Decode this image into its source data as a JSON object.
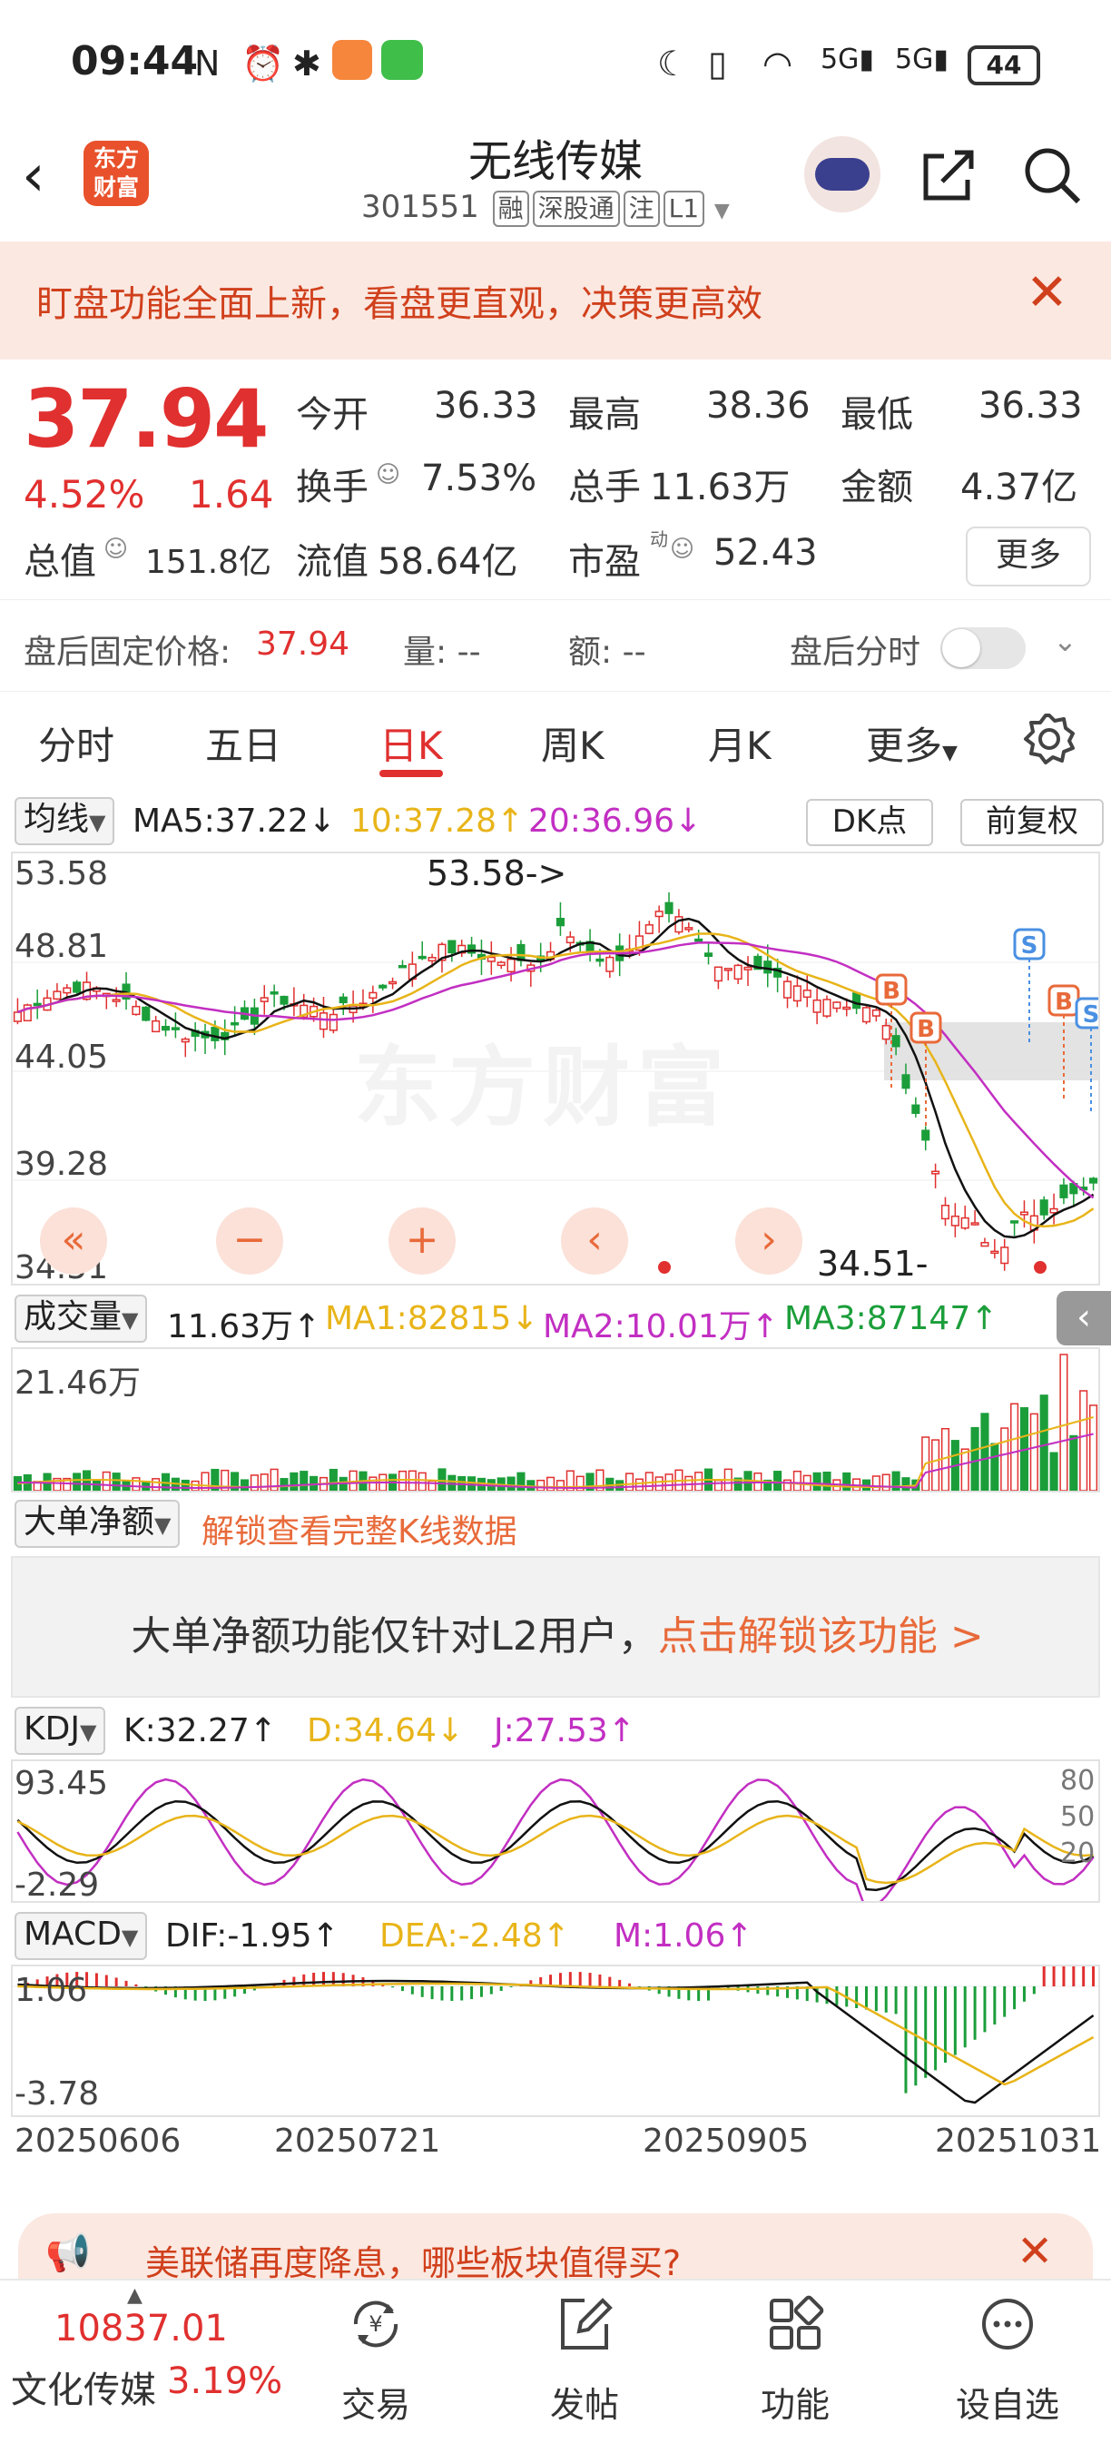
{
  "status_bar": {
    "time": "09:44",
    "battery": "44"
  },
  "header": {
    "logo_text": "东方财富",
    "stock_name": "无线传媒",
    "stock_code": "301551",
    "tags": [
      "融",
      "深股通",
      "注",
      "L1"
    ]
  },
  "banner": {
    "text": "盯盘功能全面上新，看盘更直观，决策更高效",
    "close": "✕"
  },
  "quote": {
    "price": "37.94",
    "change_pct": "4.52%",
    "change": "1.64",
    "fields": [
      {
        "label": "今开",
        "value": "36.33",
        "color": "#e0302f"
      },
      {
        "label": "最高",
        "value": "38.36",
        "color": "#e0302f"
      },
      {
        "label": "最低",
        "value": "36.33",
        "color": "#e0302f"
      },
      {
        "label": "换手",
        "value": "7.53%",
        "color": "#333333"
      },
      {
        "label": "总手",
        "value": "11.63万",
        "color": "#333333"
      },
      {
        "label": "金额",
        "value": "4.37亿",
        "color": "#333333"
      }
    ],
    "market_cap_label": "总值",
    "market_cap": "151.8亿",
    "float_cap_label": "流值",
    "float_cap": "58.64亿",
    "pe_label": "市盈",
    "pe_sup": "动",
    "pe": "52.43",
    "more_button": "更多"
  },
  "after_hours": {
    "price_label": "盘后固定价格:",
    "price": "37.94",
    "volume_label": "量: --",
    "amount_label": "额: --",
    "timeshare_label": "盘后分时"
  },
  "tabs": [
    "分时",
    "五日",
    "日K",
    "周K",
    "月K",
    "更多"
  ],
  "active_tab": "日K",
  "kline": {
    "selector": "均线",
    "ma5": "MA5:37.22↓",
    "ma10": "10:37.28↑",
    "ma20": "20:36.96↓",
    "dk_button": "DK点",
    "adjust_button": "前复权",
    "y_top": "53.58",
    "y_2": "48.81",
    "y_3": "44.05",
    "y_4": "39.28",
    "y_bottom": "34.51",
    "max_marker": "53.58->",
    "min_marker": "34.51-",
    "watermark": "东方财富",
    "signals": [
      "B",
      "B",
      "S",
      "B",
      "S"
    ]
  },
  "nav_buttons": [
    "«",
    "−",
    "+",
    "‹",
    "›"
  ],
  "volume": {
    "selector": "成交量",
    "value": "11.63万↑",
    "ma1": "MA1:82815↓",
    "ma2": "MA2:10.01万↑",
    "ma3": "MA3:87147↑",
    "y_top": "21.46万"
  },
  "big_order": {
    "selector": "大单净额",
    "unlock_link": "解锁查看完整K线数据",
    "panel_text": "大单净额功能仅针对L2用户，",
    "panel_link": "点击解锁该功能 >"
  },
  "kdj": {
    "selector": "KDJ",
    "k": "K:32.27↑",
    "d": "D:34.64↓",
    "j": "J:27.53↑",
    "y_top": "93.45",
    "y_bottom": "-2.29",
    "r_80": "80",
    "r_50": "50",
    "r_20": "20"
  },
  "macd": {
    "selector": "MACD",
    "dif": "DIF:-1.95↑",
    "dea": "DEA:-2.48↑",
    "m": "M:1.06↑",
    "y_top": "1.06",
    "y_bottom": "-3.78"
  },
  "dates": [
    "20250606",
    "20250721",
    "20250905",
    "20251031"
  ],
  "ad": {
    "text": "美联储再度降息，哪些板块值得买?",
    "close": "✕"
  },
  "bottom_nav": {
    "index_value": "10837.01",
    "index_name": "文化传媒",
    "index_pct": "3.19%",
    "items": [
      "交易",
      "发帖",
      "功能",
      "设自选"
    ]
  },
  "colors": {
    "up": "#e0302f",
    "down": "#1b9e3a",
    "ma5": "#111111",
    "ma10": "#e8b419",
    "ma20": "#c22fc2",
    "accent": "#e8512b"
  }
}
